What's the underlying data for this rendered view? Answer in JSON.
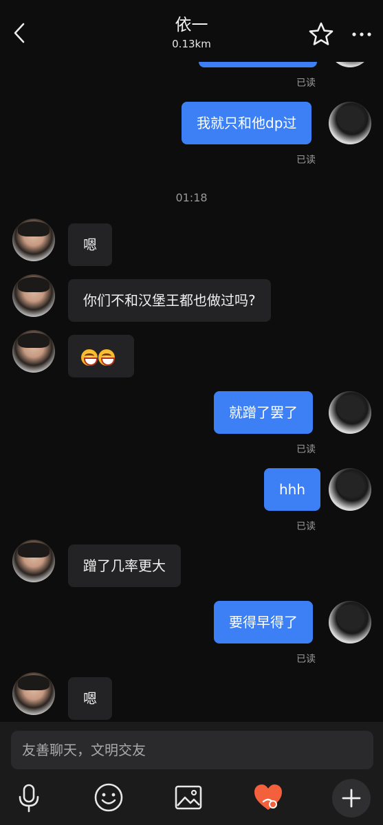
{
  "header": {
    "title": "依一",
    "subtitle": "0.13km"
  },
  "messages": [
    {
      "from": "me",
      "text": "",
      "status": "已读"
    },
    {
      "from": "me",
      "text": "我就只和他dp过",
      "status": "已读"
    },
    {
      "time": "01:18"
    },
    {
      "from": "them",
      "text": "嗯"
    },
    {
      "from": "them",
      "text": "你们不和汉堡王都也做过吗?"
    },
    {
      "from": "them",
      "emoji": [
        "grinning-face-emoji",
        "grinning-face-emoji"
      ]
    },
    {
      "from": "me",
      "text": "就蹭了罢了",
      "status": "已读"
    },
    {
      "from": "me",
      "text": "hhh",
      "status": "已读"
    },
    {
      "from": "them",
      "text": "蹭了几率更大"
    },
    {
      "from": "me",
      "text": "要得早得了",
      "status": "已读"
    },
    {
      "from": "them",
      "text": "嗯"
    }
  ],
  "input": {
    "placeholder": "友善聊天，文明交友"
  },
  "toolbar": {
    "icons": [
      "microphone-icon",
      "emoji-icon",
      "image-icon",
      "heart-gift-icon",
      "plus-icon"
    ]
  },
  "colors": {
    "my_bubble": "#3d80f6",
    "their_bubble": "#232325",
    "background": "#0d0d0e",
    "heart": "#f2603c"
  }
}
